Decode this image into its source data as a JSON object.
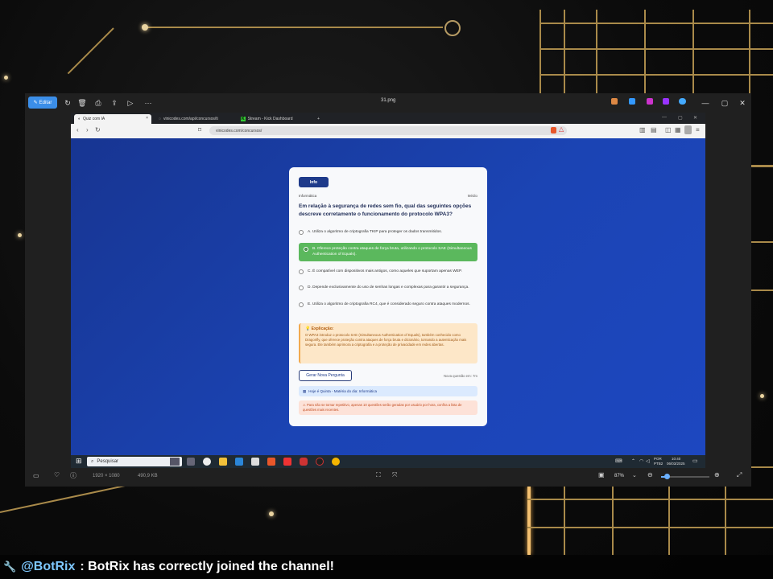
{
  "viewer": {
    "edit_label": "Editar",
    "file_title": "31.png",
    "status_dimensions": "1920 × 1080",
    "status_size": "490,9 KB",
    "zoom": "87%"
  },
  "browser": {
    "tabs": [
      {
        "label": "Quiz com IA"
      },
      {
        "label": "vinicodes.com/api/concursos/ti"
      },
      {
        "label": "Stream - Kick Dashboard"
      }
    ],
    "url": "vinicodes.com/concursos/"
  },
  "quiz": {
    "badge": "Info",
    "category": "Informática",
    "level": "Médio",
    "question": "Em relação à segurança de redes sem fio, qual das seguintes opções descreve corretamente o funcionamento do protocolo WPA3?",
    "options": [
      {
        "text": "A. Utiliza o algoritmo de criptografia TKIP para proteger os dados transmitidos.",
        "selected": false
      },
      {
        "text": "B. Oferece proteção contra ataques de força bruta, utilizando o protocolo SAE (Simultaneous Authentication of Equals).",
        "selected": true
      },
      {
        "text": "C. É compatível com dispositivos mais antigos, como aqueles que suportam apenas WEP.",
        "selected": false
      },
      {
        "text": "D. Depende exclusivamente do uso de senhas longas e complexas para garantir a segurança.",
        "selected": false
      },
      {
        "text": "E. Utiliza o algoritmo de criptografia RC4, que é considerado seguro contra ataques modernos.",
        "selected": false
      }
    ],
    "explanation_title": "Explicação:",
    "explanation": "O WPA3 introduz o protocolo SAE (Simultaneous Authentication of Equals), também conhecido como Dragonfly, que oferece proteção contra ataques de força bruta e dicionário, tornando a autenticação mais segura. Ele também aprimora a criptografia e a proteção de privacidade em redes abertas.",
    "new_question_button": "Gerar Nova Pergunta",
    "next_question": "Nova questão em: 7m",
    "today": "Hoje é Quinta - Matéria do dia: Informática",
    "warning": "Para não se tornar repetitivo, apenas 10 questões serão geradas por usuário por hora, confira a lista de questões mais recentes."
  },
  "taskbar": {
    "search_placeholder": "Pesquisar",
    "lang": "POR",
    "lang2": "PTB2",
    "time": "10:40",
    "date": "06/03/2025"
  },
  "chat": {
    "username": "@BotRix",
    "message": ": BotRix has correctly joined the channel!"
  },
  "colors": {
    "accent": "#1e3a8a",
    "selected": "#5bb85d",
    "page_bg": "#1b44b4",
    "explanation_bg": "#fde7c8"
  }
}
